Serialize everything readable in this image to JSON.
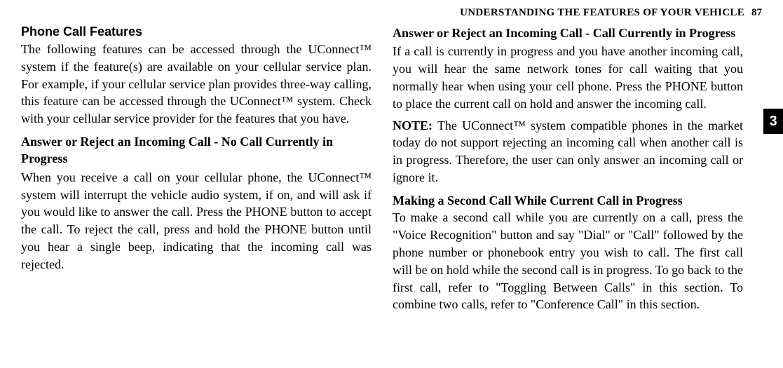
{
  "header": {
    "title": "UNDERSTANDING THE FEATURES OF YOUR VEHICLE",
    "page_number": "87"
  },
  "side_tab": "3",
  "left_column": {
    "section_title": "Phone Call Features",
    "intro_para": "The following features can be accessed through the UConnect™ system if the feature(s) are available on your cellular service plan. For example, if your cellular service plan provides three-way calling, this feature can be accessed through the UConnect™ system. Check with your cellular service provider for the features that you have.",
    "sub1_heading": "Answer or Reject an Incoming Call - No Call Currently in Progress",
    "sub1_para": "When you receive a call on your cellular phone, the UConnect™ system will interrupt the vehicle audio system, if on, and will ask if you would like to answer the call. Press the PHONE button to accept the call. To reject the call, press and hold the PHONE button until you hear a single beep, indicating that the incoming call was rejected."
  },
  "right_column": {
    "sub2_heading": "Answer or Reject an Incoming Call - Call Currently in Progress",
    "sub2_para": "If a call is currently in progress and you have another incoming call, you will hear the same network tones for call waiting that you normally hear when using your cell phone. Press the PHONE button to place the current call on hold and answer the incoming call.",
    "note_label": "NOTE:",
    "note_para": " The UConnect™ system compatible phones in the market today do not support rejecting an incoming call when another call is in progress. Therefore, the user can only answer an incoming call or ignore it.",
    "sub3_heading": "Making a Second Call While Current Call in Progress",
    "sub3_para": "To make a second call while you are currently on a call, press the \"Voice Recognition\" button and say \"Dial\" or \"Call\" followed by the phone number or phonebook entry you wish to call. The first call will be on hold while the second call is in progress. To go back to the first call, refer to \"Toggling Between Calls\" in this section. To combine two calls, refer to \"Conference Call\" in this section."
  }
}
